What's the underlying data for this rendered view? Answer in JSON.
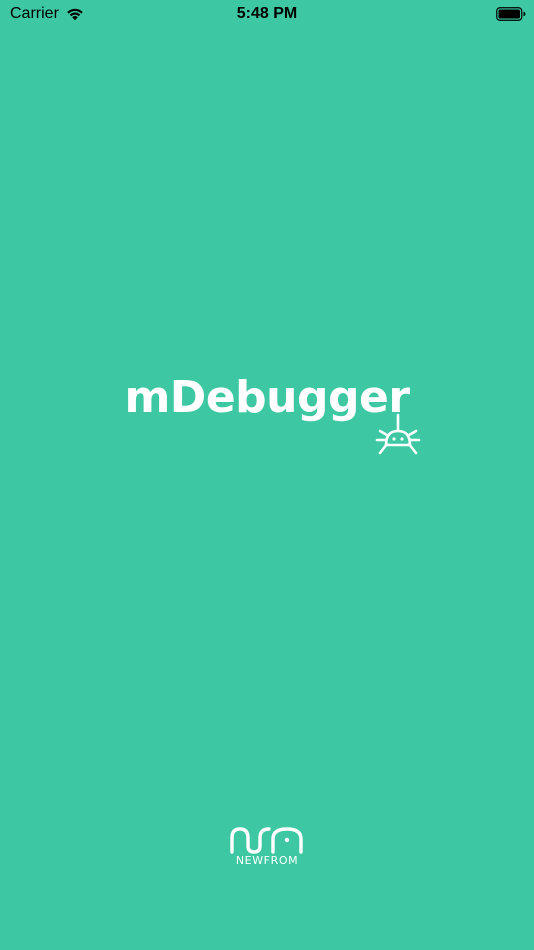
{
  "status_bar": {
    "carrier": "Carrier",
    "time": "5:48 PM",
    "icons": [
      "wifi-icon",
      "battery-icon"
    ]
  },
  "splash": {
    "app_name": "mDebugger",
    "icon": "bug-icon"
  },
  "footer": {
    "brand_name": "NEWFROM",
    "icon": "newfrom-logo-icon"
  },
  "colors": {
    "background": "#3dc8a3",
    "foreground": "#ffffff",
    "status_text": "#000000"
  }
}
